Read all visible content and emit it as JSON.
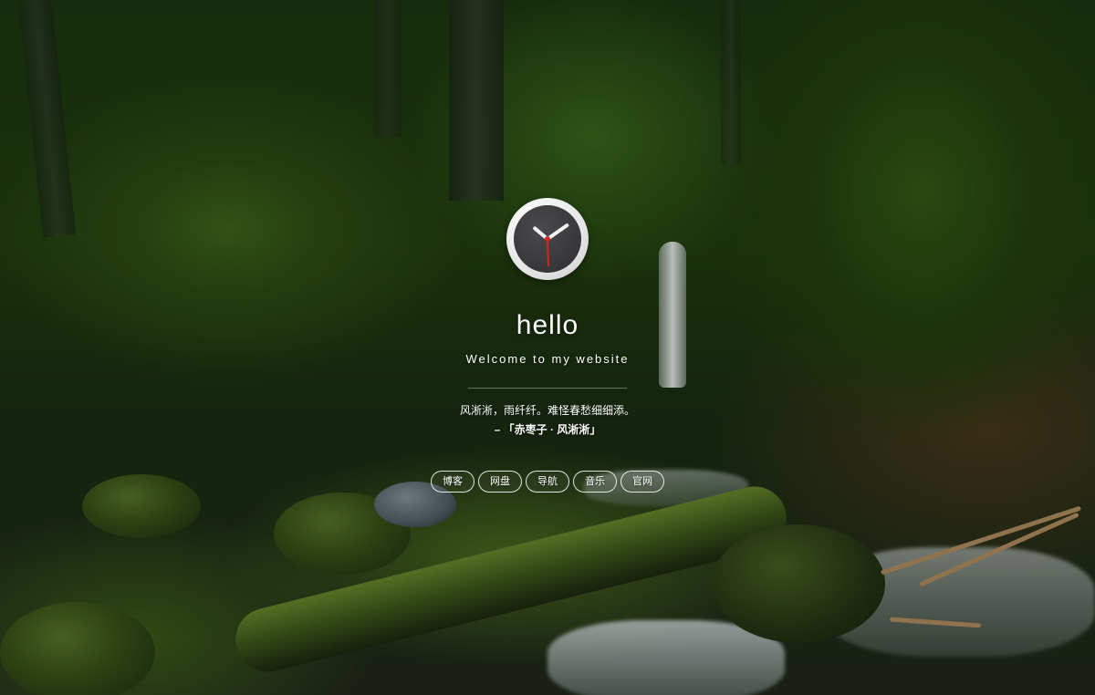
{
  "hero": {
    "title": "hello",
    "subtitle": "Welcome to my website",
    "quote": "风淅淅，雨纤纤。难怪春愁细细添。",
    "quote_source": "– 「赤枣子 · 风淅淅」"
  },
  "nav": {
    "items": [
      {
        "label": "博客"
      },
      {
        "label": "网盘"
      },
      {
        "label": "导航"
      },
      {
        "label": "音乐"
      },
      {
        "label": "官网"
      }
    ]
  },
  "icons": {
    "clock": "clock-icon"
  },
  "colors": {
    "text": "#ffffff",
    "clock_face": "#2f2f31",
    "clock_second_hand": "#d8241c"
  }
}
